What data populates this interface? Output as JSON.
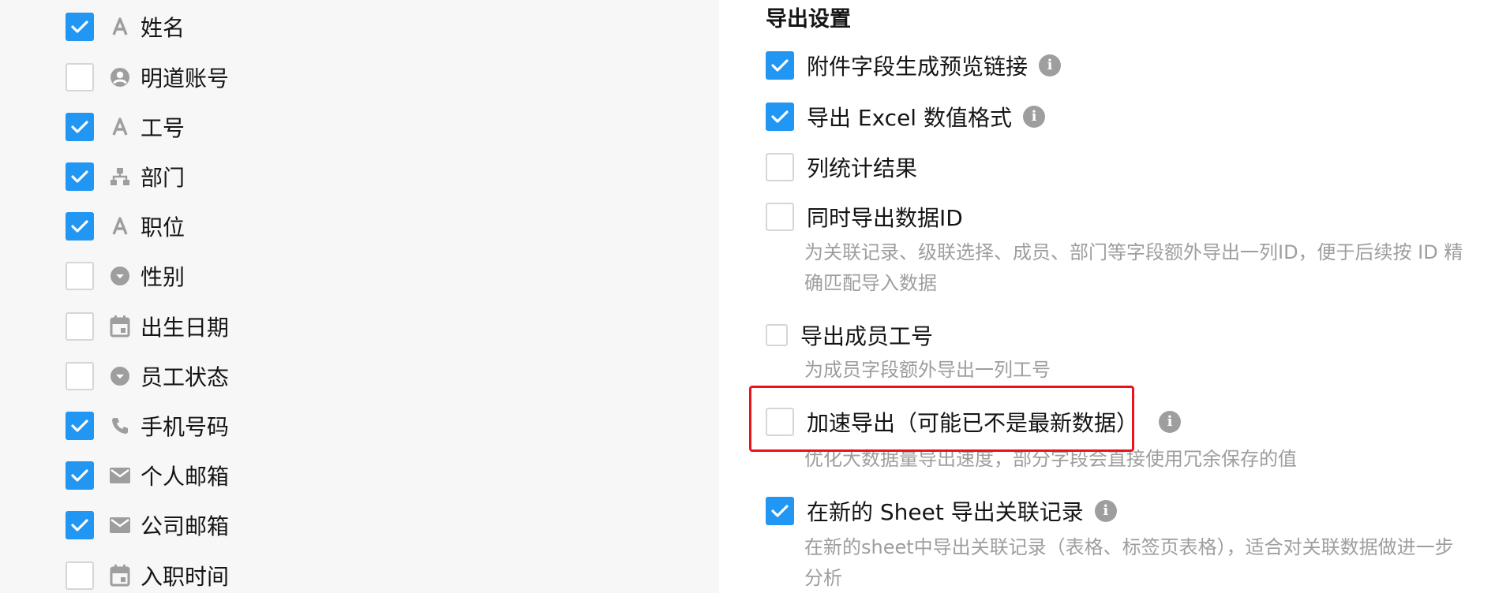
{
  "fields": [
    {
      "label": "姓名",
      "checked": true,
      "icon": "text-icon"
    },
    {
      "label": "明道账号",
      "checked": false,
      "icon": "user-circle-icon"
    },
    {
      "label": "工号",
      "checked": true,
      "icon": "text-icon"
    },
    {
      "label": "部门",
      "checked": true,
      "icon": "org-tree-icon"
    },
    {
      "label": "职位",
      "checked": true,
      "icon": "text-icon"
    },
    {
      "label": "性别",
      "checked": false,
      "icon": "dropdown-circle-icon"
    },
    {
      "label": "出生日期",
      "checked": false,
      "icon": "calendar-icon"
    },
    {
      "label": "员工状态",
      "checked": false,
      "icon": "dropdown-circle-icon"
    },
    {
      "label": "手机号码",
      "checked": true,
      "icon": "phone-icon"
    },
    {
      "label": "个人邮箱",
      "checked": true,
      "icon": "mail-icon"
    },
    {
      "label": "公司邮箱",
      "checked": true,
      "icon": "mail-icon"
    },
    {
      "label": "入职时间",
      "checked": false,
      "icon": "calendar-icon"
    }
  ],
  "export_settings": {
    "title": "导出设置",
    "options": [
      {
        "label": "附件字段生成预览链接",
        "checked": true,
        "info": true,
        "desc": ""
      },
      {
        "label": "导出 Excel 数值格式",
        "checked": true,
        "info": true,
        "desc": ""
      },
      {
        "label": "列统计结果",
        "checked": false,
        "info": false,
        "desc": ""
      },
      {
        "label": "同时导出数据ID",
        "checked": false,
        "info": false,
        "desc": "为关联记录、级联选择、成员、部门等字段额外导出一列ID，便于后续按 ID 精确匹配导入数据"
      },
      {
        "label": "导出成员工号",
        "checked": false,
        "info": false,
        "desc": "为成员字段额外导出一列工号"
      },
      {
        "label": "加速导出（可能已不是最新数据）",
        "checked": false,
        "info": true,
        "desc": "优化大数据量导出速度，部分字段会直接使用冗余保存的值"
      },
      {
        "label": "在新的 Sheet 导出关联记录",
        "checked": true,
        "info": true,
        "desc": "在新的sheet中导出关联记录（表格、标签页表格），适合对关联数据做进一步分析"
      }
    ]
  },
  "colors": {
    "accent": "#2196f3",
    "highlight": "#e8141b",
    "icon_gray": "#9e9e9e",
    "desc_gray": "#9e9e9e"
  }
}
